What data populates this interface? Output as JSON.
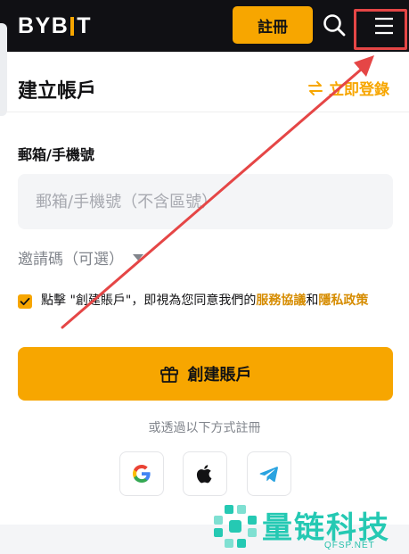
{
  "header": {
    "logo_left": "BYB",
    "logo_right": "T",
    "register_label": "註冊"
  },
  "form": {
    "title": "建立帳戶",
    "login_link": "立即登錄",
    "email_label": "郵箱/手機號",
    "email_placeholder": "郵箱/手機號（不含區號）",
    "invite_label": "邀請碼（可選）",
    "agree_prefix": "點擊 \"創建賬戶\"，即視為您同意我們的",
    "agree_terms": "服務協議",
    "agree_and": "和",
    "agree_privacy": "隱私政策",
    "agree_checked": true,
    "create_label": "創建賬戶",
    "or_text": "或透過以下方式註冊"
  },
  "social": [
    "google-icon",
    "apple-icon",
    "telegram-icon"
  ],
  "watermark": {
    "name": "量链科技",
    "domain": "QFSP.NET"
  },
  "colors": {
    "accent": "#f7a600",
    "header_bg": "#101014",
    "annotation": "#e54646",
    "watermark": "#25c9b3"
  }
}
